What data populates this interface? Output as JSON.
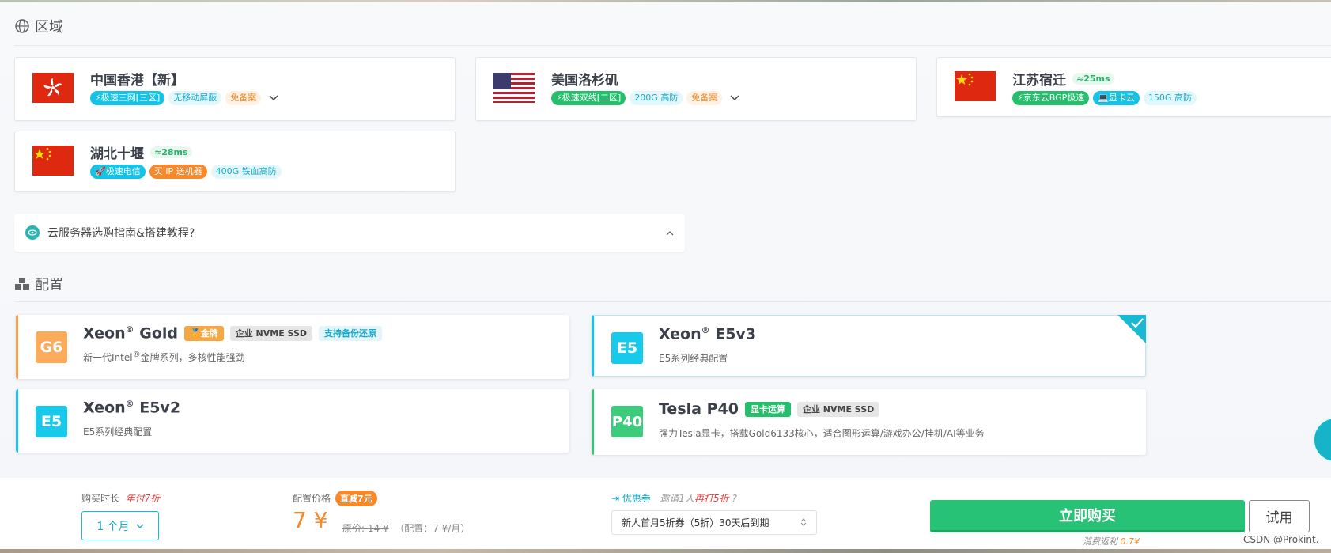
{
  "region_section": {
    "title": "区域"
  },
  "regions": [
    {
      "name": "中国香港【新】",
      "ping": "",
      "tags": [
        "⚡极速三网[三区]",
        "无移动屏蔽",
        "免备案"
      ],
      "expandable": true
    },
    {
      "name": "美国洛杉矶",
      "ping": "",
      "tags": [
        "⚡极速双线[二区]",
        "200G 高防",
        "免备案"
      ],
      "expandable": true
    },
    {
      "name": "江苏宿迁",
      "ping": "≈25ms",
      "tags": [
        "⚡京东云BGP极速",
        "💻显卡云",
        "150G 高防"
      ],
      "expandable": false
    },
    {
      "name": "湖北十堰",
      "ping": "≈28ms",
      "tags": [
        "🚀极速电信",
        "买 IP 送机器",
        "400G 铁血高防"
      ],
      "expandable": false
    }
  ],
  "guide": {
    "text": "云服务器选购指南&搭建教程?"
  },
  "config_section": {
    "title": "配置"
  },
  "configs": [
    {
      "badge": "G6",
      "name": "Xeon",
      "sup": "®",
      "name2": "Gold",
      "tags": [
        "🏅金牌",
        "企业 NVME SSD",
        "支持备份还原"
      ],
      "desc": "新一代Intel",
      "desc_sup": "®",
      "desc2": "金牌系列，多核性能强劲",
      "selected": false
    },
    {
      "badge": "E5",
      "name": "Xeon",
      "sup": "®",
      "name2": "E5v3",
      "tags": [],
      "desc": "E5系列经典配置",
      "selected": true
    },
    {
      "badge": "E5",
      "name": "Xeon",
      "sup": "®",
      "name2": "E5v2",
      "tags": [],
      "desc": "E5系列经典配置",
      "selected": false
    },
    {
      "badge": "P40",
      "name": "Tesla P40",
      "tags": [
        "显卡运算",
        "企业 NVME SSD"
      ],
      "desc": "强力Tesla显卡，搭载Gold6133核心，适合图形运算/游戏办公/挂机/AI等业务",
      "selected": false
    }
  ],
  "footer": {
    "duration_label": "购买时长",
    "duration_promo": "年付7折",
    "duration_value": "1 个月",
    "price_label": "配置价格",
    "price_promo": "直减7元",
    "price_value": "7 ¥",
    "price_original_label": "原价:",
    "price_original": "14 ¥",
    "price_config": "（配置：7 ¥/月）",
    "coupon_label": "优惠券",
    "coupon_invite_a": "邀请1人",
    "coupon_invite_b": "再打5折",
    "coupon_help": "?",
    "coupon_value": "新人首月5折券（5折）30天后到期",
    "buy_label": "立即购买",
    "trial_label": "试用",
    "rebate_label": "消费返利",
    "rebate_value": "0.7¥",
    "watermark": "CSDN @Prokint."
  },
  "colors": {
    "accent_green": "#28c277",
    "accent_cyan": "#19c4e6",
    "accent_orange": "#f7892a"
  }
}
